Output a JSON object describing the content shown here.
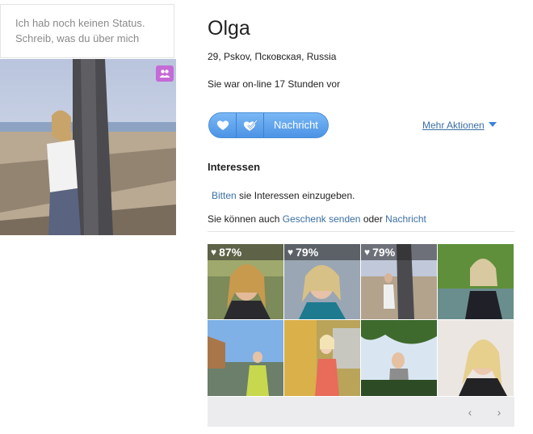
{
  "status": {
    "placeholder": "Ich hab noch keinen Status. Schreib, was du über mich"
  },
  "profile": {
    "name": "Olga",
    "location": "29,  Pskov, Псковская, Russia",
    "online": "Sie war on-line 17 Stunden vor"
  },
  "actions": {
    "message_label": "Nachricht",
    "more_label": "Mehr Aktionen",
    "icons": [
      "heart-icon",
      "heart-check-icon",
      "chevron-down-icon",
      "friends-icon"
    ]
  },
  "interests": {
    "title": "Interessen",
    "ask_link": "Bitten",
    "ask_text": " sie Interessen einzugeben.",
    "gift_prefix": "Sie können auch ",
    "gift_link": "Geschenk senden",
    "gift_or": " oder ",
    "message_link": "Nachricht"
  },
  "gallery": {
    "ratings": [
      "87%",
      "79%",
      "79%"
    ],
    "nav_prev": "‹",
    "nav_next": "›"
  },
  "colors": {
    "accent": "#4c93e6",
    "link": "#3b6fa5",
    "badge": "#c56ad6"
  }
}
